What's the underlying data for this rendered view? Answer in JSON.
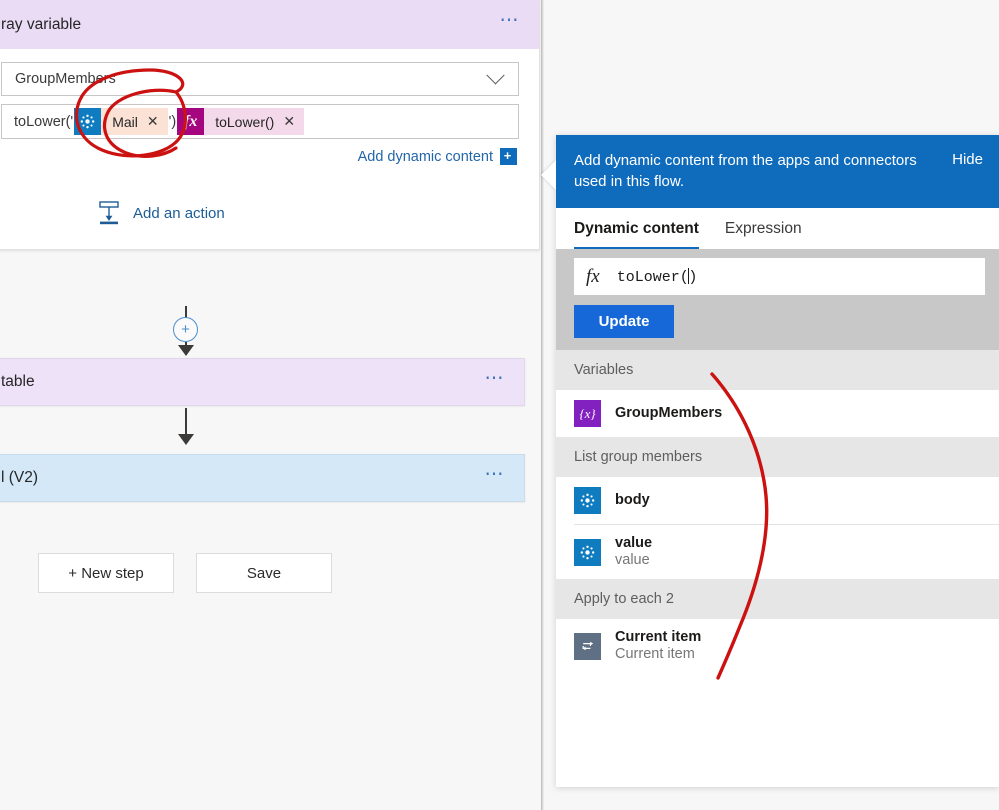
{
  "action_card": {
    "title": "ray variable",
    "menu_icon": "ellipsis-icon",
    "name_field": {
      "value": "GroupMembers",
      "chevron_icon": "chevron-down-icon"
    },
    "value_field": {
      "prefix_text": "toLower('",
      "suffix_text": "')",
      "tokens": [
        {
          "icon": "azure-ad-icon",
          "label": "Mail",
          "remove_icon": "close-icon",
          "kind": "aad"
        },
        {
          "icon": "fx-icon",
          "label": "toLower()",
          "remove_icon": "close-icon",
          "kind": "fx"
        }
      ]
    },
    "add_dynamic_content": {
      "label": "Add dynamic content",
      "plus_icon": "+"
    },
    "add_an_action": {
      "label": "Add an action",
      "icon": "insert-action-icon"
    }
  },
  "flow": {
    "insert_node_glyph": "+",
    "steps": [
      {
        "title": "table",
        "menu_icon": "ellipsis-icon"
      },
      {
        "title": "l (V2)",
        "menu_icon": "ellipsis-icon"
      }
    ]
  },
  "buttons": {
    "new_step": "+ New step",
    "save": "Save"
  },
  "dynamic_panel": {
    "header_text": "Add dynamic content from the apps and connectors used in this flow.",
    "hide_label": "Hide",
    "tabs": [
      {
        "label": "Dynamic content",
        "active": true
      },
      {
        "label": "Expression",
        "active": false
      }
    ],
    "expression": {
      "fx_glyph": "fx",
      "value_before_caret": "toLower(",
      "value_after_caret": ")"
    },
    "update_label": "Update",
    "groups": [
      {
        "header": "Variables",
        "items": [
          {
            "icon": "variable-icon",
            "icon_glyph": "{x}",
            "kind": "var",
            "title": "GroupMembers",
            "subtitle": ""
          }
        ]
      },
      {
        "header": "List group members",
        "items": [
          {
            "icon": "azure-ad-icon",
            "kind": "aad",
            "title": "body",
            "subtitle": ""
          },
          {
            "icon": "azure-ad-icon",
            "kind": "aad",
            "title": "value",
            "subtitle": "value"
          }
        ]
      },
      {
        "header": "Apply to each 2",
        "items": [
          {
            "icon": "loop-icon",
            "kind": "loop",
            "title": "Current item",
            "subtitle": "Current item"
          }
        ]
      }
    ]
  },
  "colors": {
    "accent_blue": "#0f6cbd",
    "annotation_red": "#cc1111",
    "card_purple": "#eee2f8",
    "card_blue": "#d4e8f7",
    "header_lavender": "#eadcf5"
  }
}
